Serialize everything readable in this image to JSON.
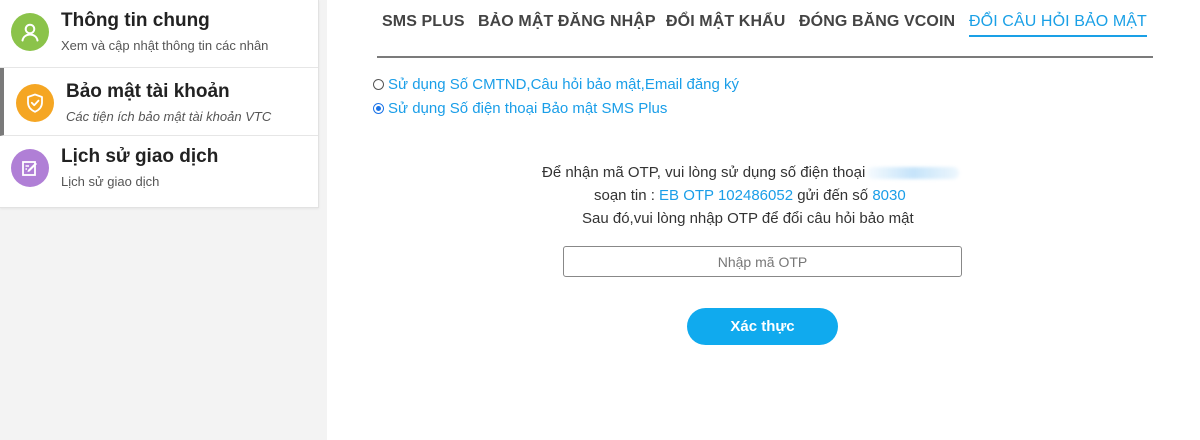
{
  "sidebar": {
    "items": [
      {
        "title": "Thông tin chung",
        "subtitle": "Xem và cập nhật thông tin các nhân",
        "icon": "user-icon",
        "color": "#8bc34a"
      },
      {
        "title": "Bảo mật tài khoản",
        "subtitle": "Các tiện ích bảo mật tài khoản VTC",
        "icon": "shield-icon",
        "color": "#f5a623"
      },
      {
        "title": "Lịch sử giao dịch",
        "subtitle": "Lịch sử giao dịch",
        "icon": "edit-icon",
        "color": "#b07fd6"
      }
    ]
  },
  "tabs": [
    "SMS PLUS",
    "BẢO MẬT ĐĂNG NHẬP",
    "ĐỔI MẬT KHẨU",
    "ĐÓNG BĂNG VCOIN",
    "ĐỔI CÂU HỎI BẢO MẬT"
  ],
  "options": {
    "option1": "Sử dụng Số CMTND,Câu hỏi bảo mật,Email đăng ký",
    "option2": "Sử dụng Số điện thoại Bảo mật SMS Plus",
    "selected": 2
  },
  "instructions": {
    "line1": "Để nhận mã OTP, vui lòng sử dụng số điện thoại",
    "line2_prefix": "soạn tin : ",
    "sms_code": "EB OTP 102486052",
    "line2_mid": " gửi đến số ",
    "short_number": "8030",
    "line3": "Sau đó,vui lòng nhập OTP để đổi câu hỏi bảo mật"
  },
  "otp": {
    "placeholder": "Nhập mã OTP",
    "value": ""
  },
  "verify_button": "Xác thực",
  "colors": {
    "accent": "#1aa0e6",
    "button": "#10aaee"
  }
}
